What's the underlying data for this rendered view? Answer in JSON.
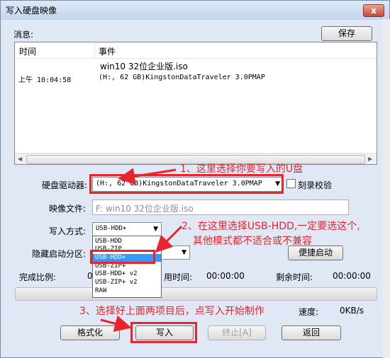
{
  "window": {
    "title": "写入硬盘映像",
    "close_label": "x"
  },
  "message": {
    "label": "消息:",
    "save_label": "保存",
    "col_time": "时间",
    "col_event": "事件",
    "rows": [
      {
        "time": "",
        "event": "win10 32位企业版.iso"
      },
      {
        "time": "上午 10:04:58",
        "event": "(H:, 62 GB)KingstonDataTraveler 3.0PMAP"
      }
    ]
  },
  "drive": {
    "label": "硬盘驱动器:",
    "value": "(H:, 62 GB)KingstonDataTraveler 3.0PMAP",
    "verify_label": "刻录校验"
  },
  "image_file": {
    "label": "映像文件:",
    "value": "F: win10 32位企业版.iso"
  },
  "write_mode": {
    "label": "写入方式:",
    "value": "USB-HDD+",
    "options": [
      "USB-HDD",
      "USB-ZIP",
      "USB-HDD+",
      "USB-ZIP+",
      "USB-HDD+ v2",
      "USB-ZIP+ v2",
      "RAW"
    ],
    "selected_index": 2
  },
  "hidden_partition": {
    "label": "隐藏启动分区:",
    "quick_boot_label": "便捷启动"
  },
  "status": {
    "complete_label": "完成比例:",
    "complete_value": "0",
    "elapsed_label": "用时间:",
    "elapsed_value": "00:00:00",
    "remaining_label": "剩余时间:",
    "remaining_value": "00:00:00",
    "speed_label": "速度:",
    "speed_value": "0KB/s",
    "progress": 0
  },
  "buttons": {
    "format": "格式化",
    "write": "写入",
    "stop": "终止[A]",
    "back": "返回"
  },
  "annotations": {
    "a1": "1、这里选择你要写入的U盘",
    "a2_line1": "2、在这里选择USB-HDD,一定要选这个,",
    "a2_line2": "其他模式都不适合或不兼容",
    "a3": "3、选择好上面两项目后，点写入开始制作"
  },
  "colors": {
    "annotation": "#e8242e",
    "selection": "#3399ff"
  }
}
